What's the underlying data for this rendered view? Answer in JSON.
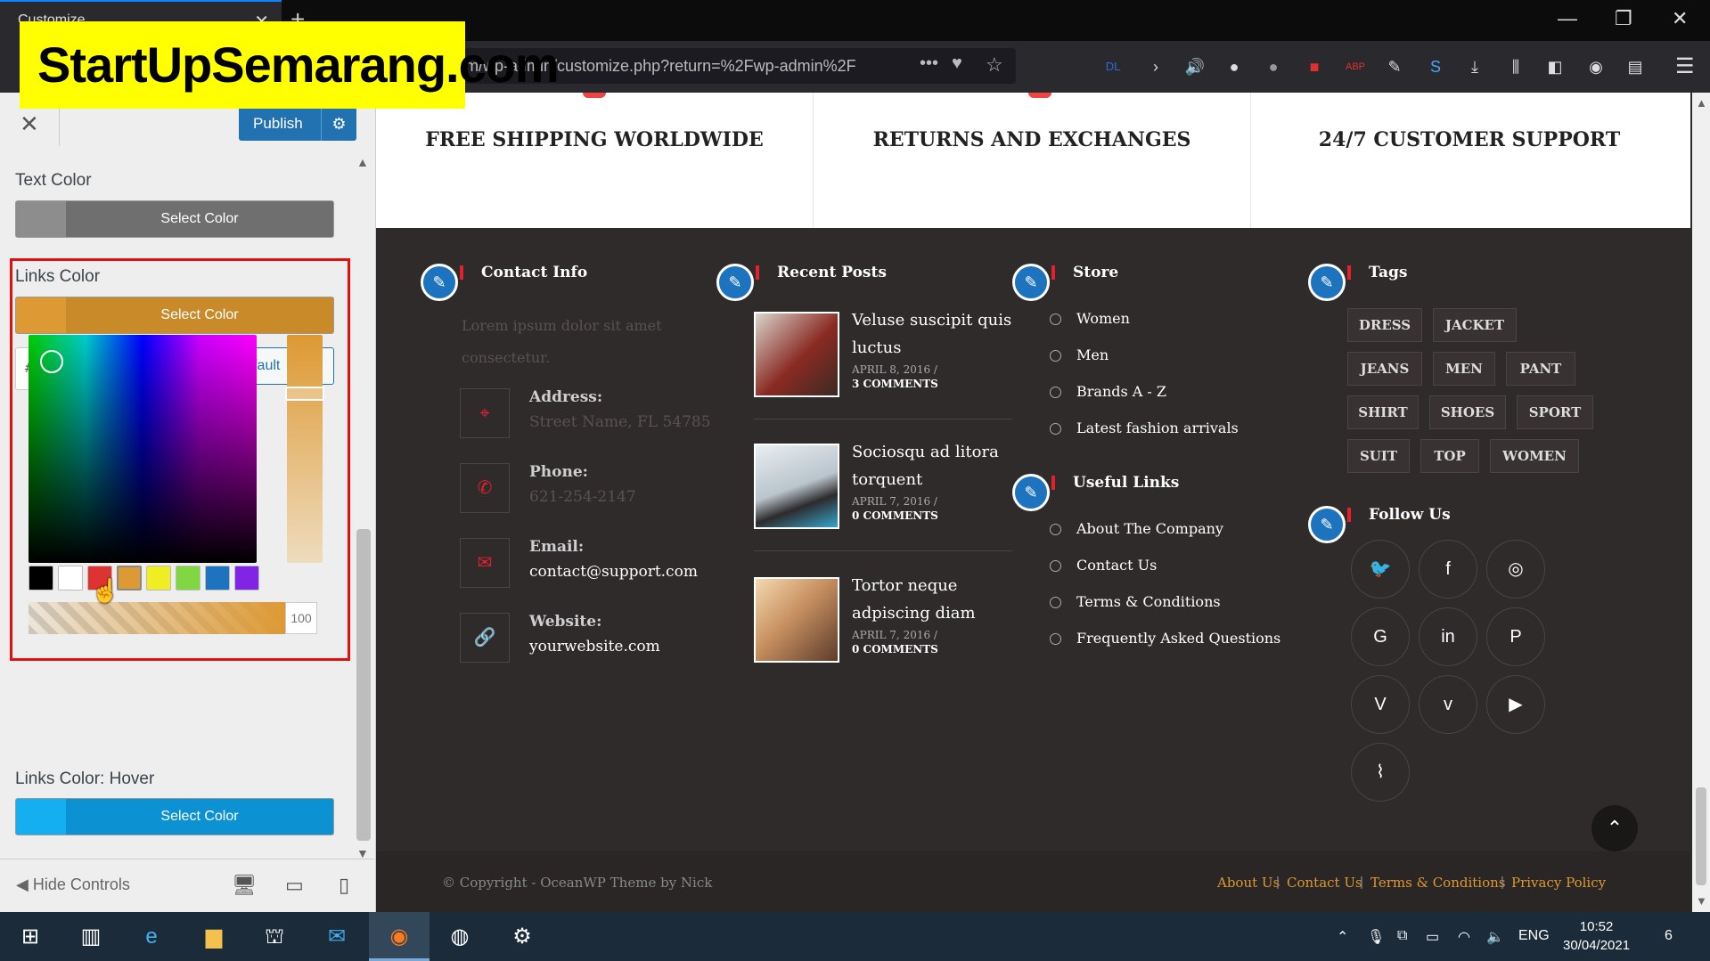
{
  "browser": {
    "tab_title": "Customize",
    "url": "m/wp-admin/customize.php?return=%2Fwp-admin%2F",
    "url_menu": "•••",
    "toolbar_icons": [
      "dl-icon",
      "forward-icon",
      "speaker-icon",
      "extension-icon",
      "extension-icon",
      "extension-icon",
      "abp-icon",
      "pen-icon",
      "s-icon",
      "download-icon",
      "library-icon",
      "sidebar-icon",
      "account-icon",
      "notes-icon",
      "menu-icon"
    ]
  },
  "watermark": "StartUpSemarang.com",
  "customizer": {
    "publish_label": "Publish",
    "text_color": {
      "label": "Text Color",
      "button": "Select Color",
      "swatch": "#8d8d8d"
    },
    "links_color": {
      "label": "Links Color",
      "button": "Select Color",
      "swatch": "#dd9933",
      "hex_value": "#dd9933",
      "default_label": "Default",
      "alpha_value": "100"
    },
    "palette": [
      "#000000",
      "#ffffff",
      "#dd3333",
      "#dd9933",
      "#eeee22",
      "#81d742",
      "#1e73be",
      "#8224e3"
    ],
    "links_hover": {
      "label": "Links Color: Hover",
      "button": "Select Color",
      "swatch": "#13aff0"
    },
    "hide_controls": "Hide Controls"
  },
  "preview": {
    "features": [
      "FREE SHIPPING WORLDWIDE",
      "RETURNS AND EXCHANGES",
      "24/7 CUSTOMER SUPPORT"
    ],
    "contact": {
      "title": "Contact Info",
      "intro": "Lorem ipsum dolor sit amet consectetur.",
      "items": [
        {
          "label": "Address:",
          "value": "Street Name, FL 54785",
          "dim": true,
          "icon": "map-pin-icon"
        },
        {
          "label": "Phone:",
          "value": "621-254-2147",
          "dim": true,
          "icon": "phone-icon"
        },
        {
          "label": "Email:",
          "value": "contact@support.com",
          "dim": false,
          "icon": "envelope-icon"
        },
        {
          "label": "Website:",
          "value": "yourwebsite.com",
          "dim": false,
          "icon": "link-icon"
        }
      ]
    },
    "recent_posts": {
      "title": "Recent Posts",
      "posts": [
        {
          "title": "Veluse suscipit quis luctus",
          "date": "APRIL 8, 2016 /",
          "comments": "3 COMMENTS"
        },
        {
          "title": "Sociosqu ad litora torquent",
          "date": "APRIL 7, 2016 /",
          "comments": "0 COMMENTS"
        },
        {
          "title": "Tortor neque adpiscing diam",
          "date": "APRIL 7, 2016 /",
          "comments": "0 COMMENTS"
        }
      ]
    },
    "store": {
      "title": "Store",
      "items": [
        "Women",
        "Men",
        "Brands A - Z",
        "Latest fashion arrivals"
      ]
    },
    "useful_links": {
      "title": "Useful Links",
      "items": [
        "About The Company",
        "Contact Us",
        "Terms & Conditions",
        "Frequently Asked Questions"
      ]
    },
    "tags": {
      "title": "Tags",
      "items": [
        "DRESS",
        "JACKET",
        "JEANS",
        "MEN",
        "PANT",
        "SHIRT",
        "SHOES",
        "SPORT",
        "SUIT",
        "TOP",
        "WOMEN"
      ]
    },
    "follow": {
      "title": "Follow Us",
      "icons": [
        "twitter-icon",
        "facebook-icon",
        "instagram-icon",
        "google-plus-icon",
        "linkedin-icon",
        "pinterest-icon",
        "vimeo-icon",
        "vine-icon",
        "youtube-icon",
        "rss-icon"
      ]
    },
    "copyright": "© Copyright - OceanWP Theme by Nick",
    "footer_links": [
      "About Us",
      "Contact Us",
      "Terms & Conditions",
      "Privacy Policy"
    ]
  },
  "taskbar": {
    "language": "ENG",
    "time": "10:52",
    "date": "30/04/2021",
    "notifications": "6"
  }
}
